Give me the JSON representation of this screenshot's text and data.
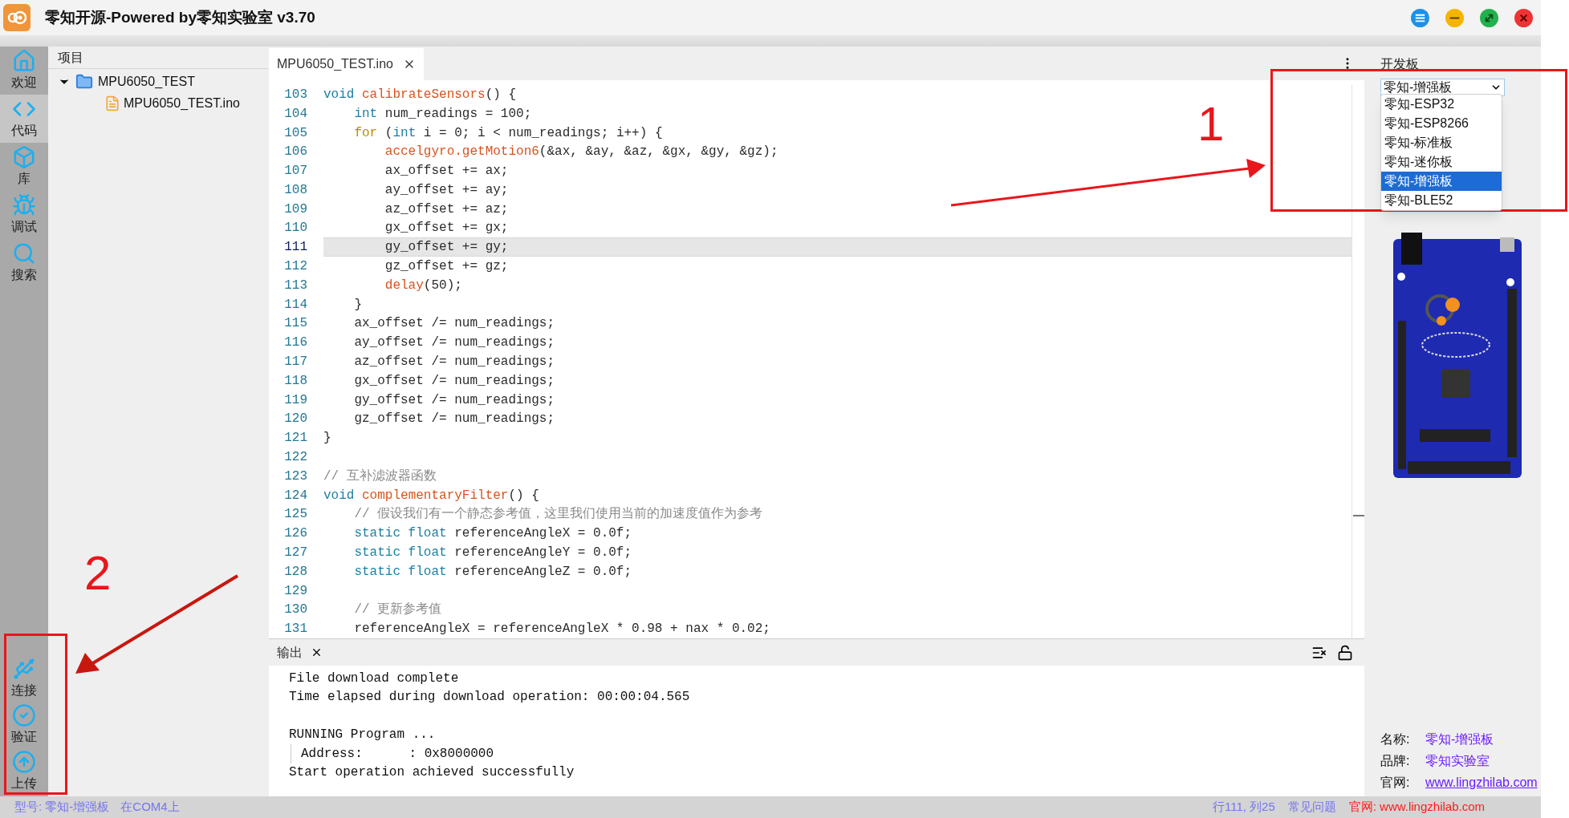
{
  "window": {
    "title": "零知开源-Powered by零知实验室 v3.70"
  },
  "sidebar": {
    "items": [
      {
        "label": "欢迎",
        "kind": "home",
        "selected": false
      },
      {
        "label": "代码",
        "kind": "code",
        "selected": true
      },
      {
        "label": "库",
        "kind": "box",
        "selected": false
      },
      {
        "label": "调试",
        "kind": "debug",
        "selected": false
      },
      {
        "label": "搜索",
        "kind": "search",
        "selected": false
      }
    ],
    "actions": [
      {
        "label": "连接",
        "kind": "usb"
      },
      {
        "label": "验证",
        "kind": "check"
      },
      {
        "label": "上传",
        "kind": "upload"
      }
    ]
  },
  "project": {
    "heading": "项目",
    "tree": [
      {
        "label": "MPU6050_TEST",
        "kind": "folder",
        "expanded": true,
        "children": [
          {
            "label": "MPU6050_TEST.ino",
            "kind": "file"
          }
        ]
      }
    ]
  },
  "editor": {
    "tabs": [
      {
        "label": "MPU6050_TEST.ino",
        "selected": true
      }
    ],
    "lines": [
      {
        "number": "103",
        "selected": false,
        "parts": [
          {
            "kind": "keyword",
            "text": "void "
          },
          {
            "kind": "function",
            "text": "calibrateSensors"
          },
          {
            "kind": "plain",
            "text": "() {"
          }
        ]
      },
      {
        "number": "104",
        "selected": false,
        "parts": [
          {
            "kind": "keyword",
            "text": "    int"
          },
          {
            "kind": "plain",
            "text": " num_readings = 100;"
          }
        ]
      },
      {
        "number": "105",
        "selected": false,
        "parts": [
          {
            "kind": "control",
            "text": "    for"
          },
          {
            "kind": "plain",
            "text": " ("
          },
          {
            "kind": "keyword",
            "text": "int"
          },
          {
            "kind": "plain",
            "text": " i = 0; i < num_readings; i++) {"
          }
        ]
      },
      {
        "number": "106",
        "selected": false,
        "parts": [
          {
            "kind": "function",
            "text": "        accelgyro.getMotion6"
          },
          {
            "kind": "plain",
            "text": "(&ax, &ay, &az, &gx, &gy, &gz);"
          }
        ]
      },
      {
        "number": "107",
        "selected": false,
        "parts": [
          {
            "kind": "plain",
            "text": "        ax_offset += ax;"
          }
        ]
      },
      {
        "number": "108",
        "selected": false,
        "parts": [
          {
            "kind": "plain",
            "text": "        ay_offset += ay;"
          }
        ]
      },
      {
        "number": "109",
        "selected": false,
        "parts": [
          {
            "kind": "plain",
            "text": "        az_offset += az;"
          }
        ]
      },
      {
        "number": "110",
        "selected": false,
        "parts": [
          {
            "kind": "plain",
            "text": "        gx_offset += gx;"
          }
        ]
      },
      {
        "number": "111",
        "selected": true,
        "parts": [
          {
            "kind": "plain",
            "text": "        gy_offset += gy;"
          }
        ]
      },
      {
        "number": "112",
        "selected": false,
        "parts": [
          {
            "kind": "plain",
            "text": "        gz_offset += gz;"
          }
        ]
      },
      {
        "number": "113",
        "selected": false,
        "parts": [
          {
            "kind": "function",
            "text": "        delay"
          },
          {
            "kind": "plain",
            "text": "(50);"
          }
        ]
      },
      {
        "number": "114",
        "selected": false,
        "parts": [
          {
            "kind": "plain",
            "text": "    }"
          }
        ]
      },
      {
        "number": "115",
        "selected": false,
        "parts": [
          {
            "kind": "plain",
            "text": "    ax_offset /= num_readings;"
          }
        ]
      },
      {
        "number": "116",
        "selected": false,
        "parts": [
          {
            "kind": "plain",
            "text": "    ay_offset /= num_readings;"
          }
        ]
      },
      {
        "number": "117",
        "selected": false,
        "parts": [
          {
            "kind": "plain",
            "text": "    az_offset /= num_readings;"
          }
        ]
      },
      {
        "number": "118",
        "selected": false,
        "parts": [
          {
            "kind": "plain",
            "text": "    gx_offset /= num_readings;"
          }
        ]
      },
      {
        "number": "119",
        "selected": false,
        "parts": [
          {
            "kind": "plain",
            "text": "    gy_offset /= num_readings;"
          }
        ]
      },
      {
        "number": "120",
        "selected": false,
        "parts": [
          {
            "kind": "plain",
            "text": "    gz_offset /= num_readings;"
          }
        ]
      },
      {
        "number": "121",
        "selected": false,
        "parts": [
          {
            "kind": "plain",
            "text": "}"
          }
        ]
      },
      {
        "number": "122",
        "selected": false
      },
      {
        "number": "123",
        "selected": false,
        "parts": [
          {
            "kind": "comment",
            "text": "// 互补滤波器函数"
          }
        ]
      },
      {
        "number": "124",
        "selected": false,
        "parts": [
          {
            "kind": "keyword",
            "text": "void "
          },
          {
            "kind": "function",
            "text": "complementaryFilter"
          },
          {
            "kind": "plain",
            "text": "() {"
          }
        ]
      },
      {
        "number": "125",
        "selected": false,
        "parts": [
          {
            "kind": "comment",
            "text": "    // 假设我们有一个静态参考值，这里我们使用当前的加速度值作为参考"
          }
        ]
      },
      {
        "number": "126",
        "selected": false,
        "parts": [
          {
            "kind": "keyword",
            "text": "    static float"
          },
          {
            "kind": "plain",
            "text": " referenceAngleX = 0.0f;"
          }
        ]
      },
      {
        "number": "127",
        "selected": false,
        "parts": [
          {
            "kind": "keyword",
            "text": "    static float"
          },
          {
            "kind": "plain",
            "text": " referenceAngleY = 0.0f;"
          }
        ]
      },
      {
        "number": "128",
        "selected": false,
        "parts": [
          {
            "kind": "keyword",
            "text": "    static float"
          },
          {
            "kind": "plain",
            "text": " referenceAngleZ = 0.0f;"
          }
        ]
      },
      {
        "number": "129",
        "selected": false
      },
      {
        "number": "130",
        "selected": false,
        "parts": [
          {
            "kind": "comment",
            "text": "    // 更新参考值"
          }
        ]
      },
      {
        "number": "131",
        "selected": false,
        "parts": [
          {
            "kind": "plain",
            "text": "    referenceAngleX = referenceAngleX * 0.98 + nax * 0.02;"
          }
        ]
      }
    ]
  },
  "output": {
    "tab": "输出",
    "lines": [
      {
        "kind": "line",
        "text": "File download complete"
      },
      {
        "kind": "line",
        "text": "Time elapsed during download operation: 00:00:04.565"
      },
      {
        "kind": "blank"
      },
      {
        "kind": "line",
        "text": "RUNNING Program ..."
      },
      {
        "kind": "detail",
        "text": "Address:      : 0x8000000"
      },
      {
        "kind": "line",
        "text": "Start operation achieved successfully"
      }
    ]
  },
  "board_panel": {
    "heading": "开发板",
    "select": {
      "value": "零知-增强板"
    },
    "options": [
      {
        "label": "零知-ESP32",
        "selected": false
      },
      {
        "label": "零知-ESP8266",
        "selected": false
      },
      {
        "label": "零知-标准板",
        "selected": false
      },
      {
        "label": "零知-迷你板",
        "selected": false
      },
      {
        "label": "零知-增强板",
        "selected": true
      },
      {
        "label": "零知-BLE52",
        "selected": false
      }
    ],
    "info": [
      {
        "label": "名称:",
        "value": "零知-增强板"
      },
      {
        "label": "品牌:",
        "value": "零知实验室"
      },
      {
        "label": "官网:",
        "value": "www.lingzhilab.com"
      }
    ]
  },
  "status_bar": {
    "left": [
      {
        "kind": "info",
        "text": "型号: 零知-增强板"
      },
      {
        "kind": "info",
        "text": "在COM4上"
      }
    ],
    "right": [
      {
        "kind": "info",
        "text": "行111, 列25"
      },
      {
        "kind": "info",
        "text": "常见问题"
      },
      {
        "kind": "site",
        "text": "官网: www.lingzhilab.com"
      }
    ]
  },
  "annotations": [
    {
      "label": "1"
    },
    {
      "label": "2"
    }
  ]
}
